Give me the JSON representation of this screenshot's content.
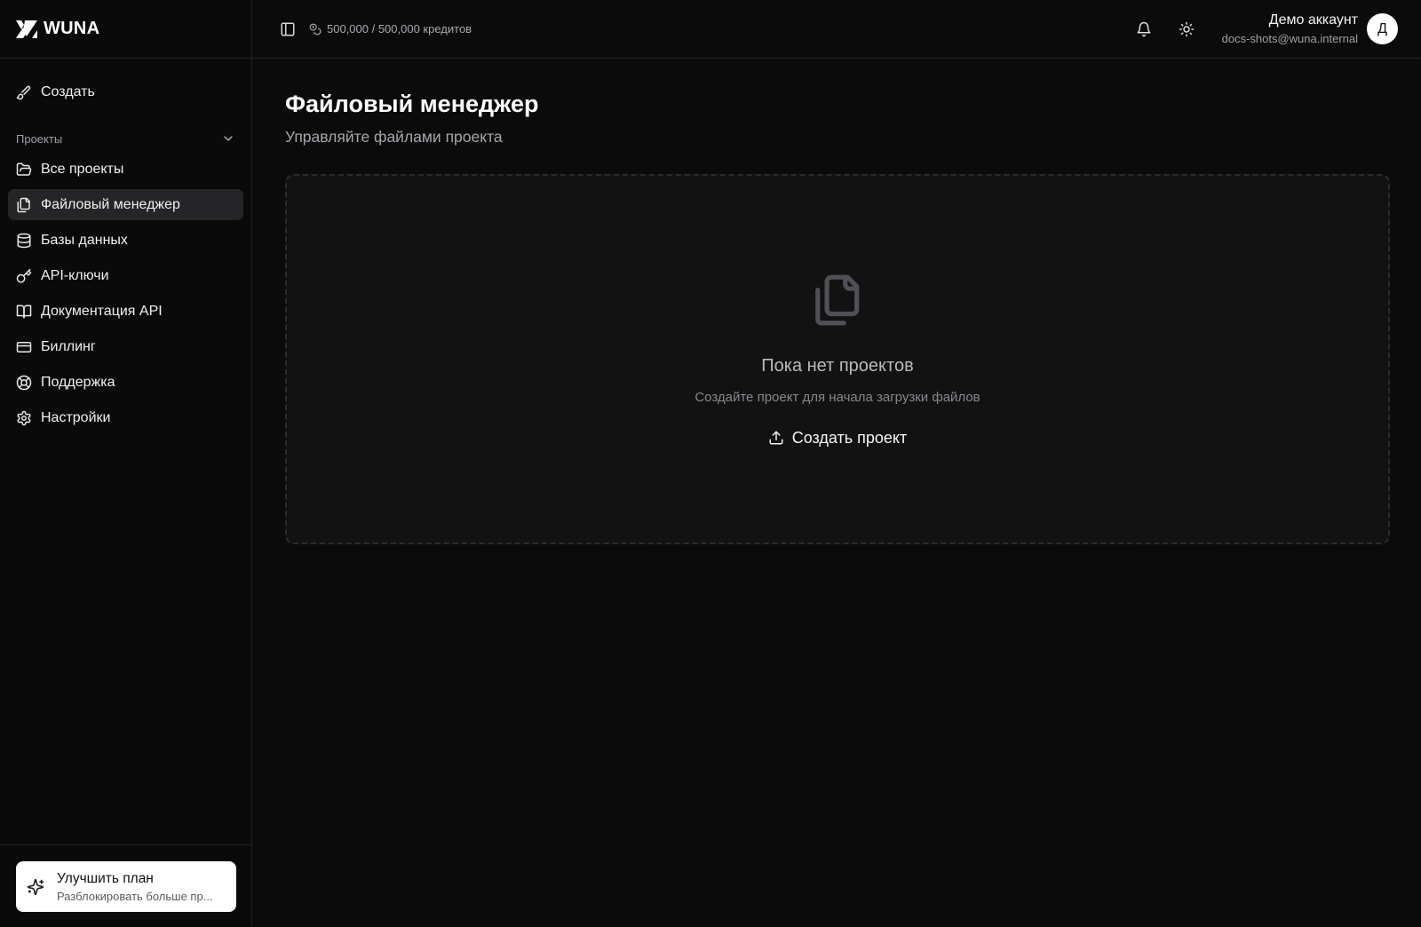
{
  "brand": {
    "name": "WUNA"
  },
  "sidebar": {
    "create_label": "Создать",
    "section_title": "Проекты",
    "items": [
      {
        "label": "Все проекты",
        "icon": "folder-open-icon"
      },
      {
        "label": "Файловый менеджер",
        "icon": "files-icon",
        "active": true
      },
      {
        "label": "Базы данных",
        "icon": "database-icon"
      },
      {
        "label": "API-ключи",
        "icon": "key-icon"
      },
      {
        "label": "Документация API",
        "icon": "book-open-icon"
      },
      {
        "label": "Биллинг",
        "icon": "credit-card-icon"
      },
      {
        "label": "Поддержка",
        "icon": "life-buoy-icon"
      },
      {
        "label": "Настройки",
        "icon": "settings-icon"
      }
    ],
    "upgrade": {
      "title": "Улучшить план",
      "subtitle": "Разблокировать больше пр..."
    }
  },
  "topbar": {
    "credits": "500,000 / 500,000 кредитов",
    "account_name": "Демо аккаунт",
    "account_email": "docs-shots@wuna.internal",
    "avatar_letter": "Д"
  },
  "main": {
    "title": "Файловый менеджер",
    "subtitle": "Управляйте файлами проекта",
    "empty_title": "Пока нет проектов",
    "empty_subtitle": "Создайте проект для начала загрузки файлов",
    "create_project_label": "Создать проект"
  },
  "colors": {
    "background": "#0b0b0c",
    "sidebar": "#0a0a0b",
    "active_item": "#252528",
    "dropzone": "#121213",
    "border": "#232326"
  }
}
